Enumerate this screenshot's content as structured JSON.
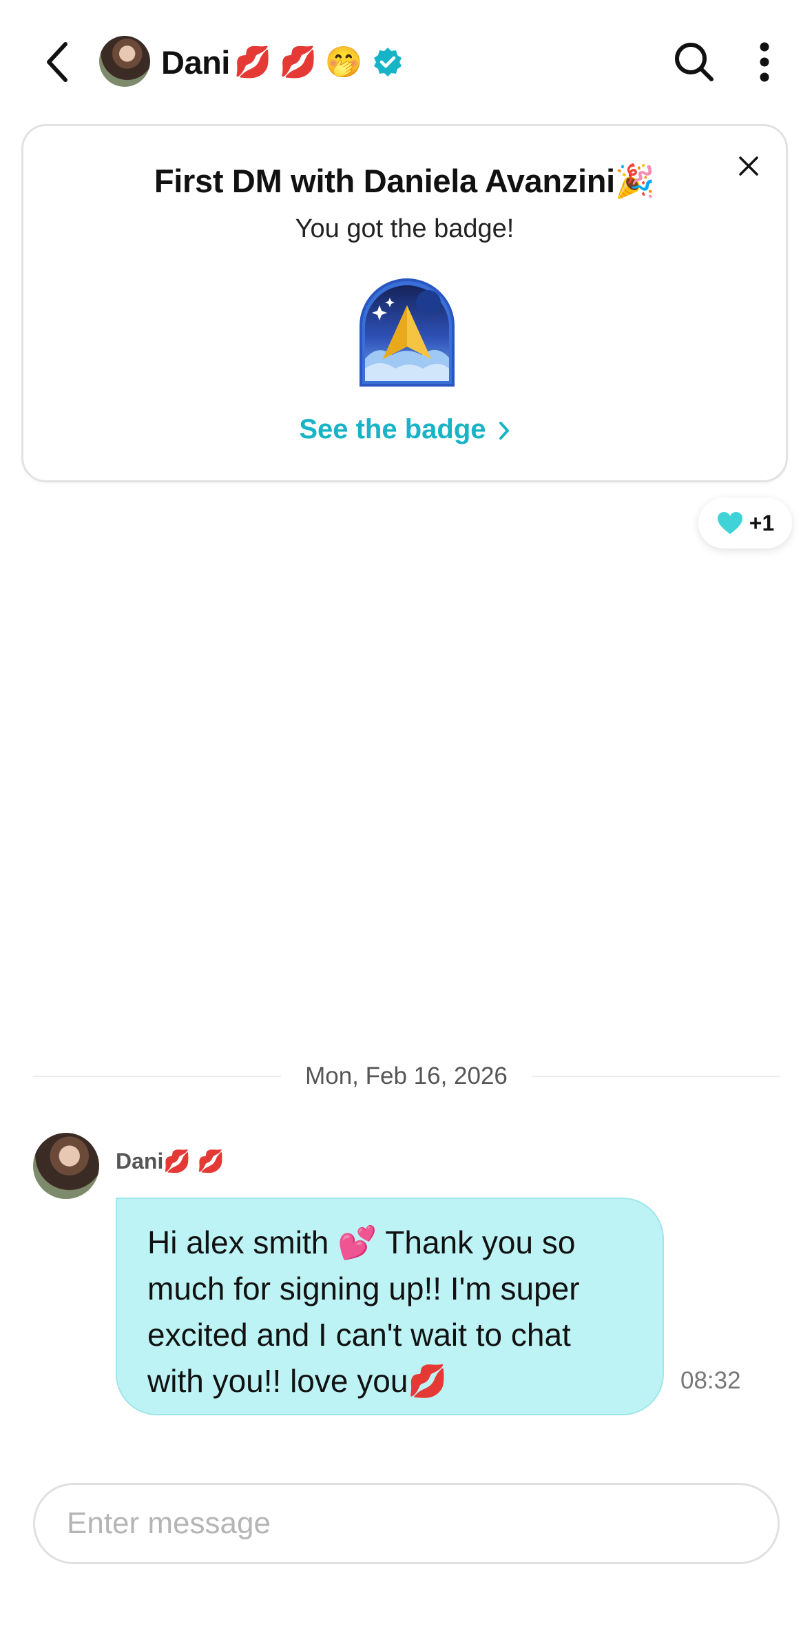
{
  "header": {
    "contact_name": "Dani",
    "name_emojis": "💋 💋  🤭",
    "icons": [
      "back-arrow-icon",
      "avatar",
      "verified-badge-icon",
      "search-icon",
      "more-vertical-icon"
    ],
    "accent_color": "#17b3c6"
  },
  "badge_card": {
    "title": "First DM with Daniela Avanzini🎉",
    "subtitle": "You got the badge!",
    "link_label": "See the badge",
    "art": "paper-plane-badge-icon",
    "close_icon": "close-icon"
  },
  "reaction": {
    "icon": "heart-icon",
    "count": "+1",
    "color": "#3fd3d8"
  },
  "conversation": {
    "date_label": "Mon, Feb 16, 2026",
    "messages": [
      {
        "sender": "Dani💋 💋",
        "text": "Hi alex smith 💕 Thank you so much for signing up!! I'm super excited and I can't wait to chat with you!! love you💋",
        "time": "08:32",
        "bubble_color": "#bdf3f4"
      }
    ]
  },
  "composer": {
    "placeholder": "Enter message",
    "value": ""
  }
}
